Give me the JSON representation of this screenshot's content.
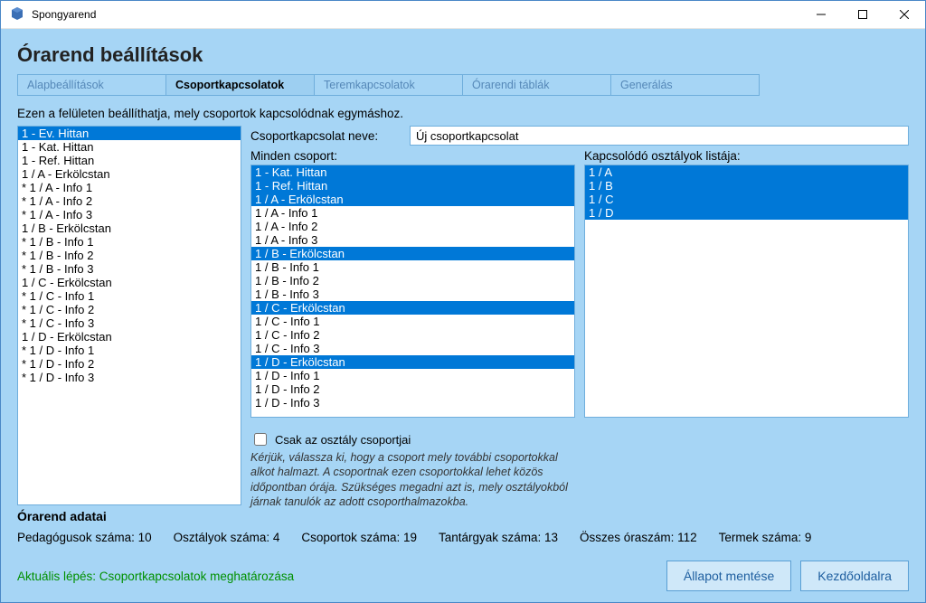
{
  "window": {
    "title": "Spongyarend"
  },
  "page": {
    "title": "Órarend beállítások",
    "description": "Ezen a felületen beállíthatja, mely csoportok kapcsolódnak egymáshoz."
  },
  "tabs": [
    {
      "label": "Alapbeállítások",
      "active": false
    },
    {
      "label": "Csoportkapcsolatok",
      "active": true
    },
    {
      "label": "Teremkapcsolatok",
      "active": false
    },
    {
      "label": "Órarendi táblák",
      "active": false
    },
    {
      "label": "Generálás",
      "active": false
    }
  ],
  "left_list": {
    "items": [
      {
        "label": "1 - Ev. Hittan",
        "selected": true
      },
      {
        "label": "1 - Kat. Hittan",
        "selected": false
      },
      {
        "label": "1 - Ref. Hittan",
        "selected": false
      },
      {
        "label": "1 / A - Erkölcstan",
        "selected": false
      },
      {
        "label": "* 1 / A - Info 1",
        "selected": false
      },
      {
        "label": "* 1 / A - Info 2",
        "selected": false
      },
      {
        "label": "* 1 / A - Info 3",
        "selected": false
      },
      {
        "label": "1 / B - Erkölcstan",
        "selected": false
      },
      {
        "label": "* 1 / B - Info 1",
        "selected": false
      },
      {
        "label": "* 1 / B - Info 2",
        "selected": false
      },
      {
        "label": "* 1 / B - Info 3",
        "selected": false
      },
      {
        "label": "1 / C - Erkölcstan",
        "selected": false
      },
      {
        "label": "* 1 / C - Info 1",
        "selected": false
      },
      {
        "label": "* 1 / C - Info 2",
        "selected": false
      },
      {
        "label": "* 1 / C - Info 3",
        "selected": false
      },
      {
        "label": "1 / D - Erkölcstan",
        "selected": false
      },
      {
        "label": "* 1 / D - Info 1",
        "selected": false
      },
      {
        "label": "* 1 / D - Info 2",
        "selected": false
      },
      {
        "label": "* 1 / D - Info 3",
        "selected": false
      }
    ]
  },
  "form": {
    "name_label": "Csoportkapcsolat neve:",
    "name_value": "Új csoportkapcsolat",
    "all_groups_label": "Minden csoport:",
    "related_classes_label": "Kapcsolódó osztályok listája:",
    "checkbox_label": "Csak az osztály csoportjai",
    "help_text": "Kérjük, válassza ki, hogy a csoport mely további csoportokkal alkot halmazt. A csoportnak ezen csoportokkal lehet közös időpontban órája. Szükséges megadni azt is, mely osztályokból járnak tanulók az adott csoporthalmazokba."
  },
  "all_groups": [
    {
      "label": "1 - Kat. Hittan",
      "selected": true
    },
    {
      "label": "1 - Ref. Hittan",
      "selected": true
    },
    {
      "label": "1 / A - Erkölcstan",
      "selected": true
    },
    {
      "label": "1 / A - Info 1",
      "selected": false
    },
    {
      "label": "1 / A - Info 2",
      "selected": false
    },
    {
      "label": "1 / A - Info 3",
      "selected": false
    },
    {
      "label": "1 / B - Erkölcstan",
      "selected": true
    },
    {
      "label": "1 / B - Info 1",
      "selected": false
    },
    {
      "label": "1 / B - Info 2",
      "selected": false
    },
    {
      "label": "1 / B - Info 3",
      "selected": false
    },
    {
      "label": "1 / C - Erkölcstan",
      "selected": true
    },
    {
      "label": "1 / C - Info 1",
      "selected": false
    },
    {
      "label": "1 / C - Info 2",
      "selected": false
    },
    {
      "label": "1 / C - Info 3",
      "selected": false
    },
    {
      "label": "1 / D - Erkölcstan",
      "selected": true
    },
    {
      "label": "1 / D - Info 1",
      "selected": false
    },
    {
      "label": "1 / D - Info 2",
      "selected": false
    },
    {
      "label": "1 / D - Info 3",
      "selected": false
    }
  ],
  "related_classes": [
    {
      "label": "1 / A",
      "selected": true
    },
    {
      "label": "1 / B",
      "selected": true
    },
    {
      "label": "1 / C",
      "selected": true
    },
    {
      "label": "1 / D",
      "selected": true
    }
  ],
  "stats": {
    "title": "Órarend adatai",
    "items": [
      {
        "label": "Pedagógusok száma:",
        "value": "10"
      },
      {
        "label": "Osztályok száma:",
        "value": "4"
      },
      {
        "label": "Csoportok száma:",
        "value": "19"
      },
      {
        "label": "Tantárgyak száma:",
        "value": "13"
      },
      {
        "label": "Összes óraszám:",
        "value": "112"
      },
      {
        "label": "Termek száma:",
        "value": "9"
      }
    ]
  },
  "footer": {
    "current_step": "Aktuális lépés: Csoportkapcsolatok meghatározása",
    "save_button": "Állapot mentése",
    "home_button": "Kezdőoldalra"
  }
}
